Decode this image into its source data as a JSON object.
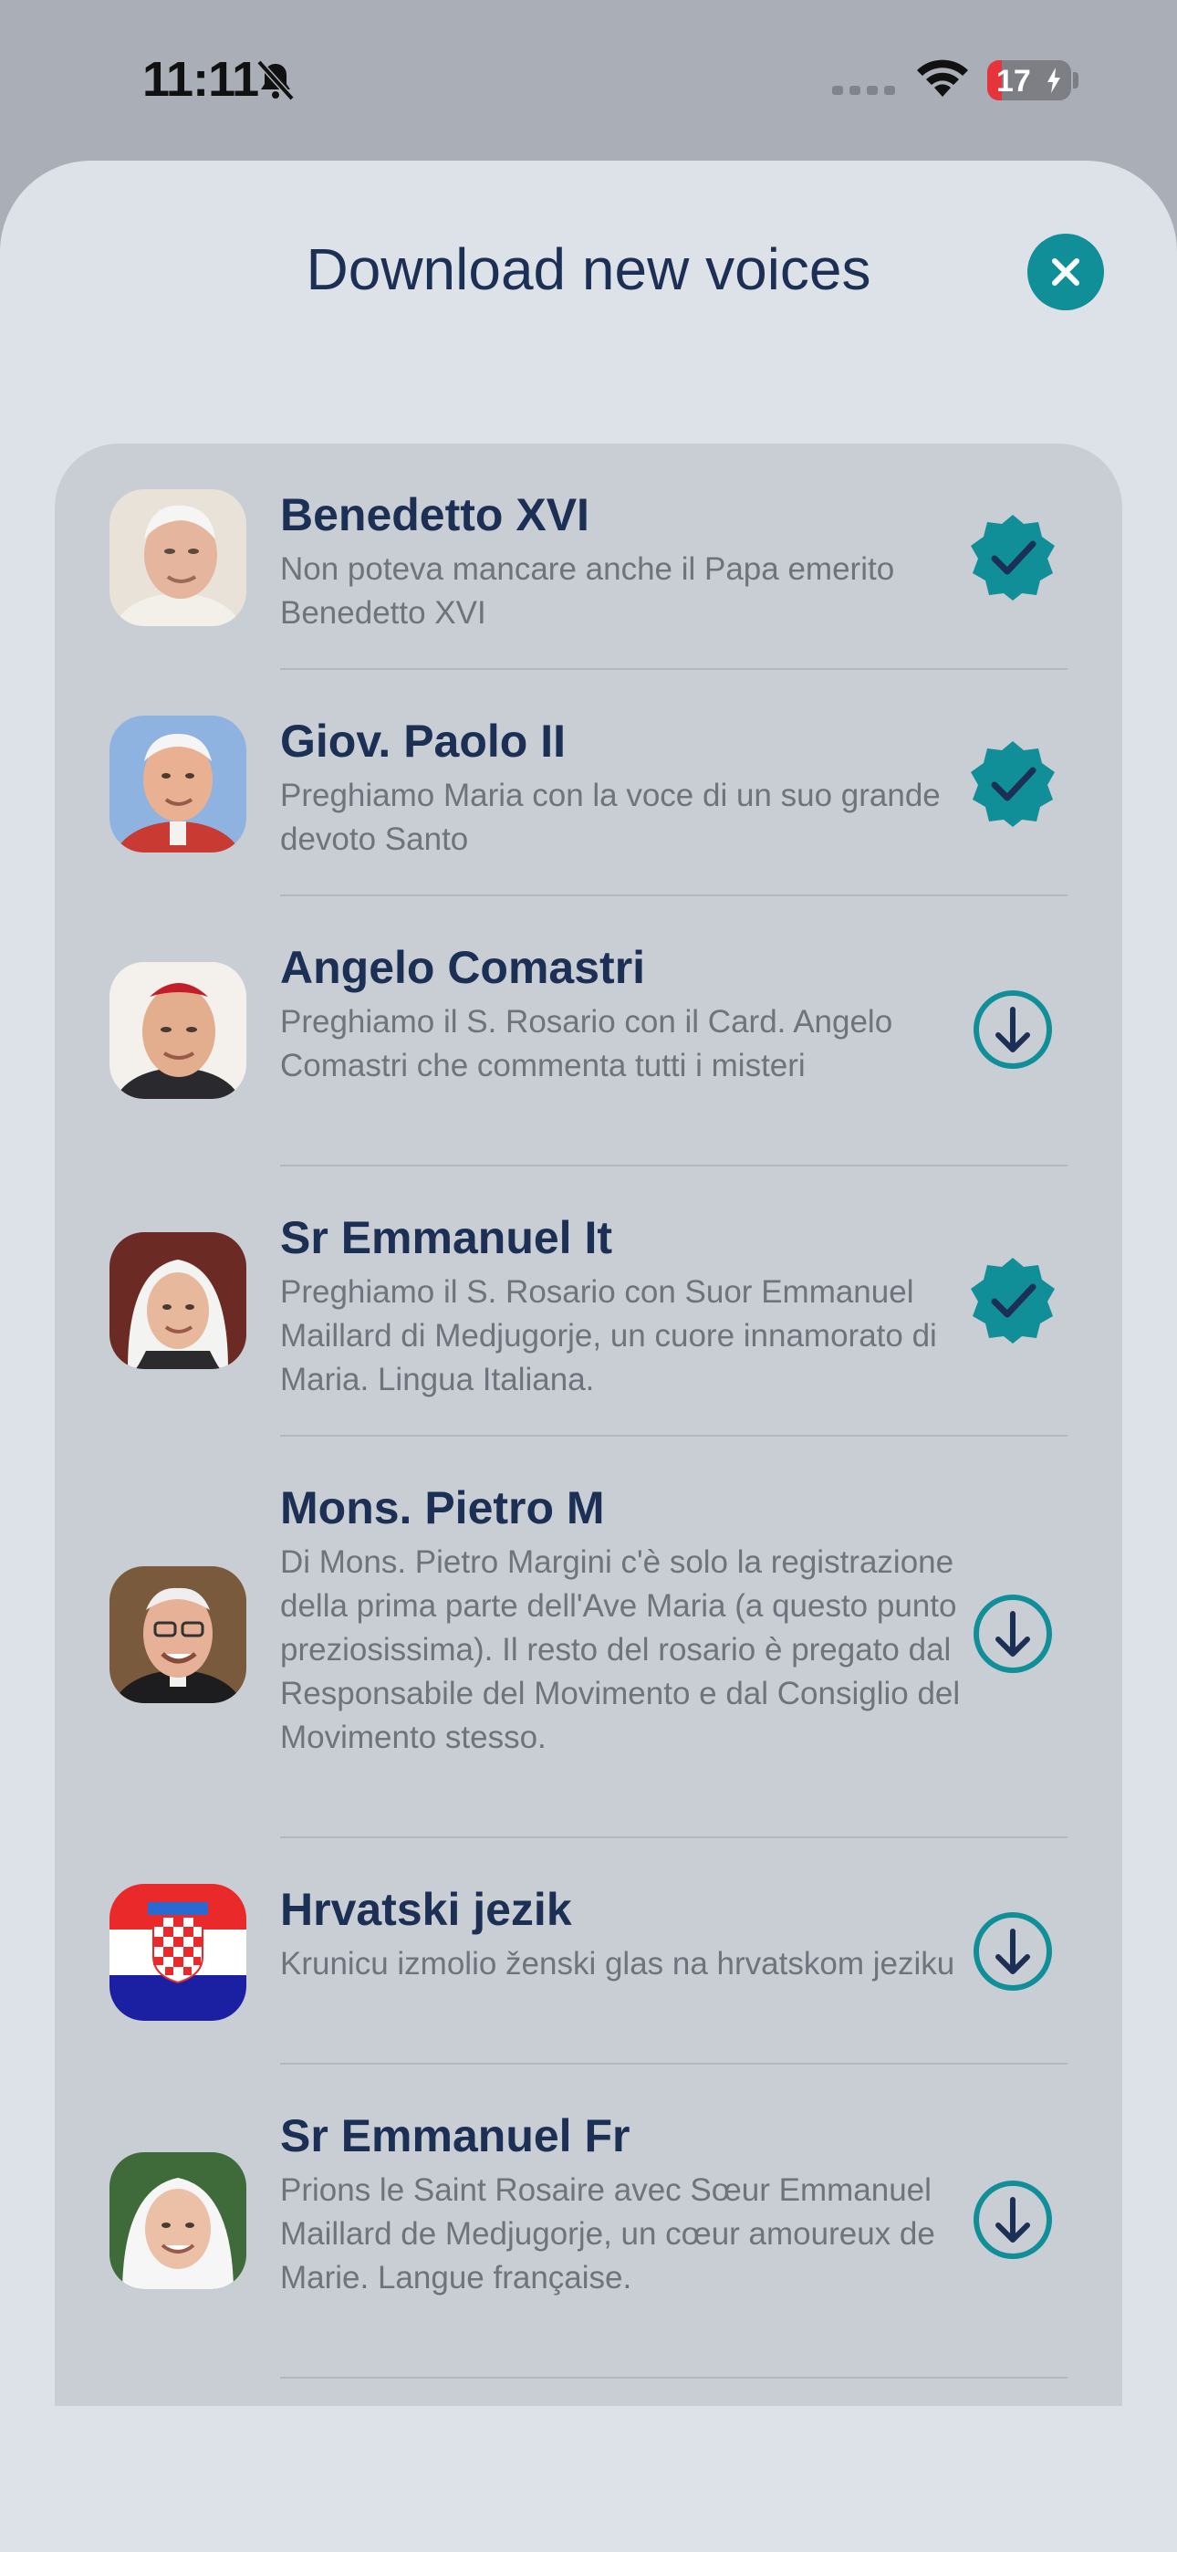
{
  "status_bar": {
    "time": "11:11",
    "battery_level": "17",
    "battery_fraction": 0.17
  },
  "sheet": {
    "title": "Download new voices",
    "close_icon": "close-icon"
  },
  "colors": {
    "accent": "#108f99",
    "title_text": "#1c2f55",
    "description_text": "#6f737b"
  },
  "voices": [
    {
      "name": "Benedetto XVI",
      "description": "Non poteva mancare anche il Papa emerito Benedetto XVI",
      "status": "downloaded",
      "icon": "verified-check-icon"
    },
    {
      "name": "Giov. Paolo II",
      "description": "Preghiamo Maria con la voce di un suo grande devoto Santo",
      "status": "downloaded",
      "icon": "verified-check-icon"
    },
    {
      "name": "Angelo Comastri",
      "description": "Preghiamo il S. Rosario con il Card. Angelo Comastri che commenta tutti i misteri",
      "status": "available",
      "icon": "download-icon"
    },
    {
      "name": "Sr Emmanuel It",
      "description": "Preghiamo il S. Rosario con Suor Emmanuel Maillard di Medjugorje, un cuore innamorato di Maria. Lingua Italiana.",
      "status": "downloaded",
      "icon": "verified-check-icon"
    },
    {
      "name": "Mons. Pietro M",
      "description": "Di Mons. Pietro Margini c'è solo la registrazione della prima parte dell'Ave Maria (a questo punto preziosissima). Il resto del rosario è pregato dal Responsabile del Movimento e dal Consiglio del Movimento stesso.",
      "status": "available",
      "icon": "download-icon"
    },
    {
      "name": "Hrvatski jezik",
      "description": "Krunicu izmolio ženski glas na hrvatskom jeziku",
      "status": "available",
      "icon": "download-icon"
    },
    {
      "name": "Sr Emmanuel Fr",
      "description": "Prions le Saint Rosaire avec Sœur Emmanuel Maillard de Medjugorje, un cœur amoureux de Marie. Langue française.",
      "status": "available",
      "icon": "download-icon"
    }
  ]
}
